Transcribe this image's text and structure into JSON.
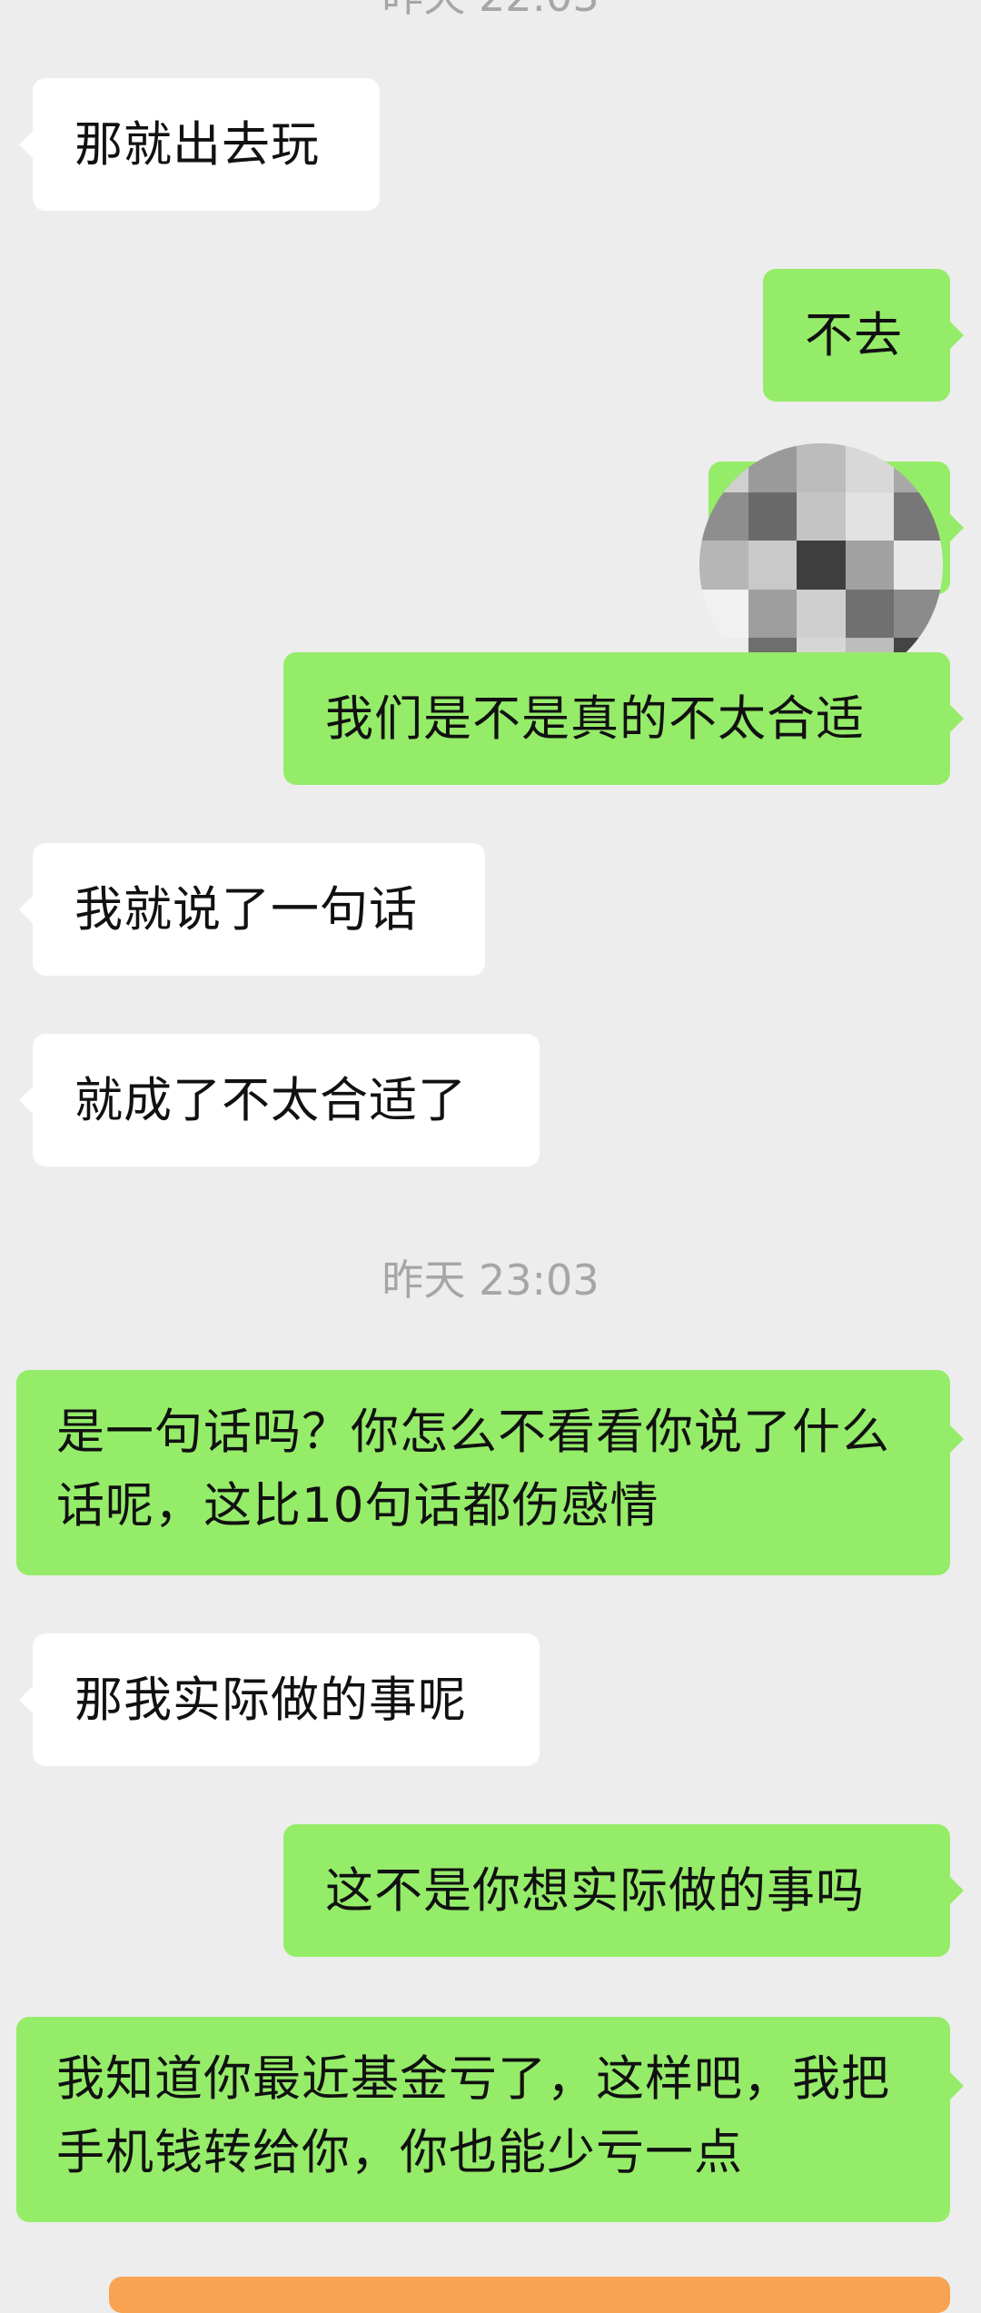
{
  "chat": {
    "timestamp_top": "昨天 22:03",
    "timestamp_mid": "昨天 23:03",
    "messages": [
      {
        "side": "in",
        "text": "那就出去玩"
      },
      {
        "side": "out",
        "text": "不去"
      },
      {
        "side": "out",
        "text": "[censored]"
      },
      {
        "side": "out",
        "text": "我们是不是真的不太合适"
      },
      {
        "side": "in",
        "text": "我就说了一句话"
      },
      {
        "side": "in",
        "text": "就成了不太合适了"
      },
      {
        "side": "out",
        "text": "是一句话吗？你怎么不看看你说了什么话呢，这比10句话都伤感情"
      },
      {
        "side": "in",
        "text": "那我实际做的事呢"
      },
      {
        "side": "out",
        "text": "这不是你想实际做的事吗"
      },
      {
        "side": "out",
        "text": "我知道你最近基金亏了，这样吧，我把手机钱转给你，你也能少亏一点"
      }
    ]
  },
  "colors": {
    "background": "#ededed",
    "incoming_bubble": "#ffffff",
    "outgoing_bubble": "#95ec69",
    "timestamp_text": "#a6a6a6",
    "bottom_card": "#f7a352"
  }
}
